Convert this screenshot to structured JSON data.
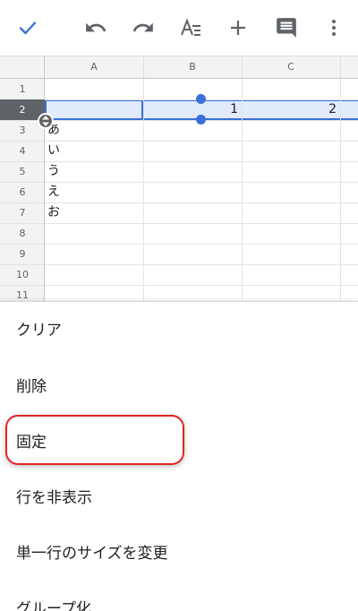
{
  "toolbar": {
    "icons": [
      "check-icon",
      "undo-icon",
      "redo-icon",
      "text-format-icon",
      "add-icon",
      "comment-icon",
      "more-vert-icon"
    ],
    "accent_color": "#3a70d8"
  },
  "grid": {
    "columns": [
      "A",
      "B",
      "C"
    ],
    "rows": [
      "1",
      "2",
      "3",
      "4",
      "5",
      "6",
      "7",
      "8",
      "9",
      "10",
      "11"
    ],
    "selected_row": "2",
    "cells": {
      "b2": "1",
      "c2": "2",
      "a3": "あ",
      "a4": "い",
      "a5": "う",
      "a6": "え",
      "a7": "お"
    },
    "selection_color": "#e1ebfc"
  },
  "menu": {
    "items": [
      "クリア",
      "削除",
      "固定",
      "行を非表示",
      "単一行のサイズを変更",
      "グループ化"
    ],
    "highlighted_item": "固定",
    "highlight_color": "#e02424"
  }
}
